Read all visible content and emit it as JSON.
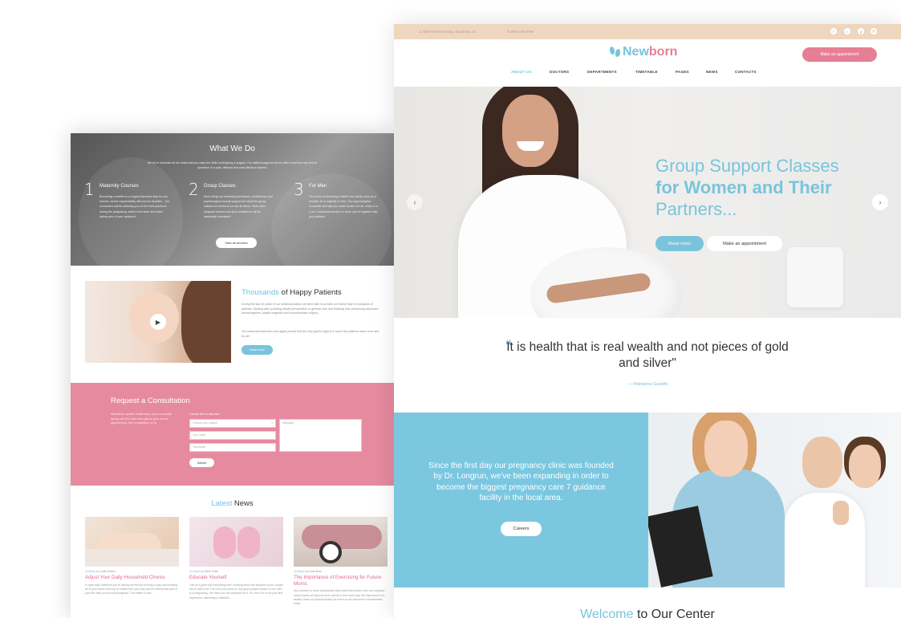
{
  "left": {
    "what_we_do": {
      "title": "What We Do",
      "intro": "We try to minimize all the strain that you may feel while undergoing a surgery. Our skilled surgeons will be able to perform any kind of operation in a safe, efficient and cost-effective manner.",
      "columns": [
        {
          "num": "1",
          "title": "Maternity Courses",
          "text": "Becoming a mother is a hugely important step for any woman, as the responsibility will now be doubled... Our counselors will be advising you on the best practices during the pregnancy, while in the labor and when taking care of your newborn!"
        },
        {
          "num": "2",
          "title": "Group Classes",
          "text": "Such things as breathing techniques, medical tips and psychological mutual support are what the group classes for moms-to-be are all about. Meet other pregnant women and your confidence will be drastically increased!"
        },
        {
          "num": "3",
          "title": "For Men",
          "text": "The news of becoming a father can easily come as a shocker for a majority of men. Our psychological counselor will help you make sense of it all, either in a 1-on-1 individual session or when you're together with your partner!"
        }
      ],
      "button": "View all services"
    },
    "happy": {
      "title_accent": "Thousands",
      "title_rest": " of Happy Patients",
      "p1": "During the last 20 years of our medical practice we were able to provide our timely help to thousands of patients. Starting with providing simple preventative or general care and finishing with performing advanced neurosurgeries, plastic surgeries and reconstructive surgery.",
      "p2": "Our seasoned team time and again proved that the only goal in sight is to solve the patient's issue once and for all!",
      "button": "Read more"
    },
    "consult": {
      "title": "Request a Consultation",
      "text": "Whichever specific health issue you're currently facing, we'll be more than glad to give you an appointment, free consultation on it!",
      "label": "I would like to discuss:",
      "select_placeholder": "Choose your subject",
      "name_placeholder": "Your name",
      "email_placeholder": "Your email",
      "message_placeholder": "Message",
      "submit": "Submit"
    },
    "news": {
      "title_accent": "Latest",
      "title_rest": " News",
      "items": [
        {
          "date": "20 March",
          "author": "by Judith Bonner",
          "title": "Adjust Your Daily Household Chores",
          "text": "In case each weekend you're having the friends of being a map and cleaning all of your house from top to bottom then you may want to rethink that part of your life once you become pregnant. The matter of fact..."
        },
        {
          "date": "20 March",
          "author": "by Sarah Smith",
          "title": "Educate Yourself",
          "text": "Just as it goes with everything else: knowing about the situation you're caught into is half a fun! The more you know on any given subject (which in our case is a pregnancy), the more you are prepared for it. So, even if it is not your first experience, attending a childbirth..."
        },
        {
          "date": "20 March",
          "author": "by Linda Ward",
          "title": "The Importance of Exercising for Future Moms",
          "text": "Any contrary to some widespread false belief that women who are pregnant should spend all days at home and lie in bed every day, the importance of a healthy share of physical activity for moms-to-be cannot be overestimated really..."
        }
      ]
    }
  },
  "right": {
    "topbar": {
      "address": "7087 Richmond hwy, Alexandria, VA",
      "phone": "800-2345-6789",
      "social_icons": [
        "facebook-icon",
        "twitter-icon",
        "google-plus-icon",
        "instagram-icon"
      ]
    },
    "logo": {
      "part1": "New",
      "part2": "born"
    },
    "appointment_button": "Make an appointment",
    "nav": [
      "ABOUT US",
      "DOCTORS",
      "DEPARTMENTS",
      "TIMETABLE",
      "PAGES",
      "NEWS",
      "CONTACTS"
    ],
    "active_nav": "ABOUT US",
    "hero": {
      "line1": "Group Support Classes",
      "line2": "for Women and Their",
      "line3": "Partners...",
      "read_more": "Read more",
      "make_appointment": "Make an appointment",
      "prev": "‹",
      "next": "›"
    },
    "quote": {
      "text": "It is health that is real wealth and not pieces of gold and silver\"",
      "author": "— Mahatma Gandhi"
    },
    "about": {
      "text": "Since the first day our pregnancy clinic was founded by Dr. Longrun, we've been expanding in order to become the biggest pregnancy care 7 guidance facility in the local area.",
      "button": "Careers"
    },
    "welcome": {
      "accent": "Welcome",
      "rest": " to Our Center"
    }
  },
  "colors": {
    "accent_blue": "#79c4dc",
    "accent_pink": "#e67f95",
    "topbar_beige": "#efd6bf",
    "consult_pink": "#e68aa0"
  }
}
